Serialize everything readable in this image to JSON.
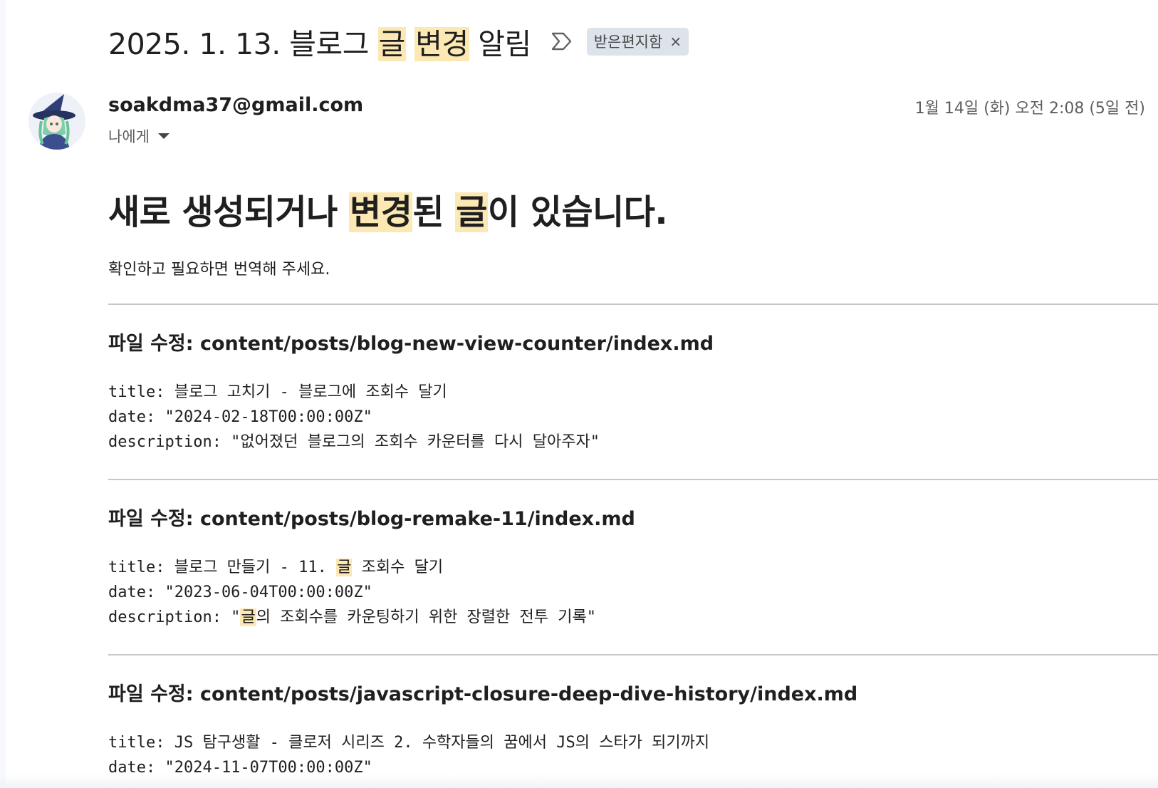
{
  "email": {
    "subject_parts": [
      {
        "text": "2025. 1. 13. 블로그 ",
        "highlight": false
      },
      {
        "text": "글",
        "highlight": true
      },
      {
        "text": " ",
        "highlight": false
      },
      {
        "text": "변경",
        "highlight": true
      },
      {
        "text": " 알림",
        "highlight": false
      }
    ],
    "label_chip": "받은편지함",
    "label_remove_glyph": "×",
    "sender": "soakdma37@gmail.com",
    "recipient": "나에게",
    "timestamp": "1월 14일 (화) 오전 2:08 (5일 전)"
  },
  "body": {
    "heading_parts": [
      {
        "text": "새로 생성되거나 ",
        "highlight": false
      },
      {
        "text": "변경",
        "highlight": true
      },
      {
        "text": "된 ",
        "highlight": false
      },
      {
        "text": "글",
        "highlight": true
      },
      {
        "text": "이 있습니다.",
        "highlight": false
      }
    ],
    "intro": "확인하고 필요하면 번역해 주세요.",
    "files": [
      {
        "heading": "파일 수정: content/posts/blog-new-view-counter/index.md",
        "lines": [
          [
            {
              "text": "title: 블로그 고치기 - 블로그에 조회수 달기",
              "highlight": false
            }
          ],
          [
            {
              "text": "date: \"2024-02-18T00:00:00Z\"",
              "highlight": false
            }
          ],
          [
            {
              "text": "description: \"없어졌던 블로그의 조회수 카운터를 다시 달아주자\"",
              "highlight": false
            }
          ]
        ]
      },
      {
        "heading": "파일 수정: content/posts/blog-remake-11/index.md",
        "lines": [
          [
            {
              "text": "title: 블로그 만들기 - 11. ",
              "highlight": false
            },
            {
              "text": "글",
              "highlight": true
            },
            {
              "text": " 조회수 달기",
              "highlight": false
            }
          ],
          [
            {
              "text": "date: \"2023-06-04T00:00:00Z\"",
              "highlight": false
            }
          ],
          [
            {
              "text": "description: \"",
              "highlight": false
            },
            {
              "text": "글",
              "highlight": true
            },
            {
              "text": "의 조회수를 카운팅하기 위한 장렬한 전투 기록\"",
              "highlight": false
            }
          ]
        ]
      },
      {
        "heading": "파일 수정: content/posts/javascript-closure-deep-dive-history/index.md",
        "lines": [
          [
            {
              "text": "title: JS 탐구생활 - 클로저 시리즈 2. 수학자들의 꿈에서 JS의 스타가 되기까지",
              "highlight": false
            }
          ],
          [
            {
              "text": "date: \"2024-11-07T00:00:00Z\"",
              "highlight": false
            }
          ]
        ]
      }
    ]
  },
  "colors": {
    "highlight": "#fce8b2",
    "chip_bg": "#dde3ea",
    "separator": "#c4c7c5",
    "muted_text": "#5e5e5e"
  },
  "icons": {
    "importance": "importance-marker-icon",
    "avatar": "witch-avatar-image",
    "recipient_caret": "caret-down-icon"
  }
}
